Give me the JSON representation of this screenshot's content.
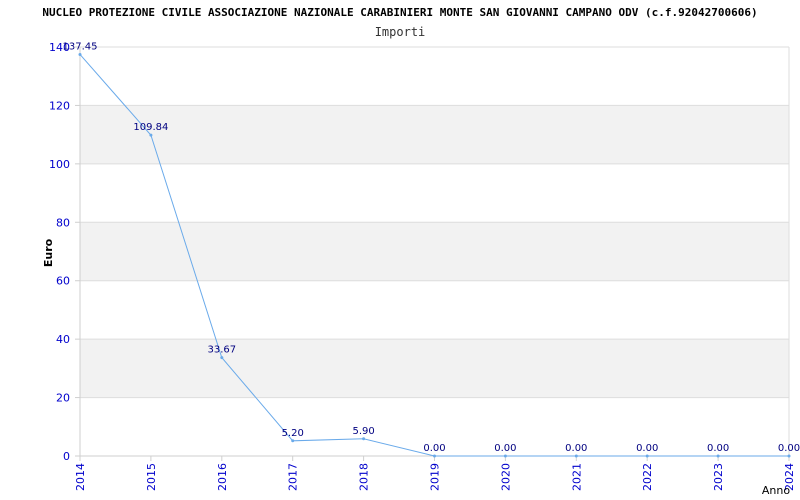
{
  "chart_data": {
    "type": "line",
    "title": "NUCLEO PROTEZIONE CIVILE ASSOCIAZIONE NAZIONALE CARABINIERI MONTE SAN GIOVANNI CAMPANO ODV (c.f.92042700606)",
    "subtitle": "Importi",
    "xlabel": "Anno",
    "ylabel": "Euro",
    "x": [
      "2014",
      "2015",
      "2016",
      "2017",
      "2018",
      "2019",
      "2020",
      "2021",
      "2022",
      "2023",
      "2024"
    ],
    "series": [
      {
        "values": [
          137.45,
          109.84,
          33.67,
          5.2,
          5.9,
          0.0,
          0.0,
          0.0,
          0.0,
          0.0,
          0.0
        ],
        "labels": [
          "137.45",
          "109.84",
          "33.67",
          "5.20",
          "5.90",
          "0.00",
          "0.00",
          "0.00",
          "0.00",
          "0.00",
          "0.00"
        ]
      }
    ],
    "ylim": [
      0,
      140
    ],
    "yticks": [
      0,
      20,
      40,
      60,
      80,
      100,
      120,
      140
    ],
    "grid": "horizontal bands",
    "line_color": "#6aaaea",
    "label_color": "#000080",
    "tick_color": "#0000cc",
    "band_color": "#f2f2f2"
  }
}
